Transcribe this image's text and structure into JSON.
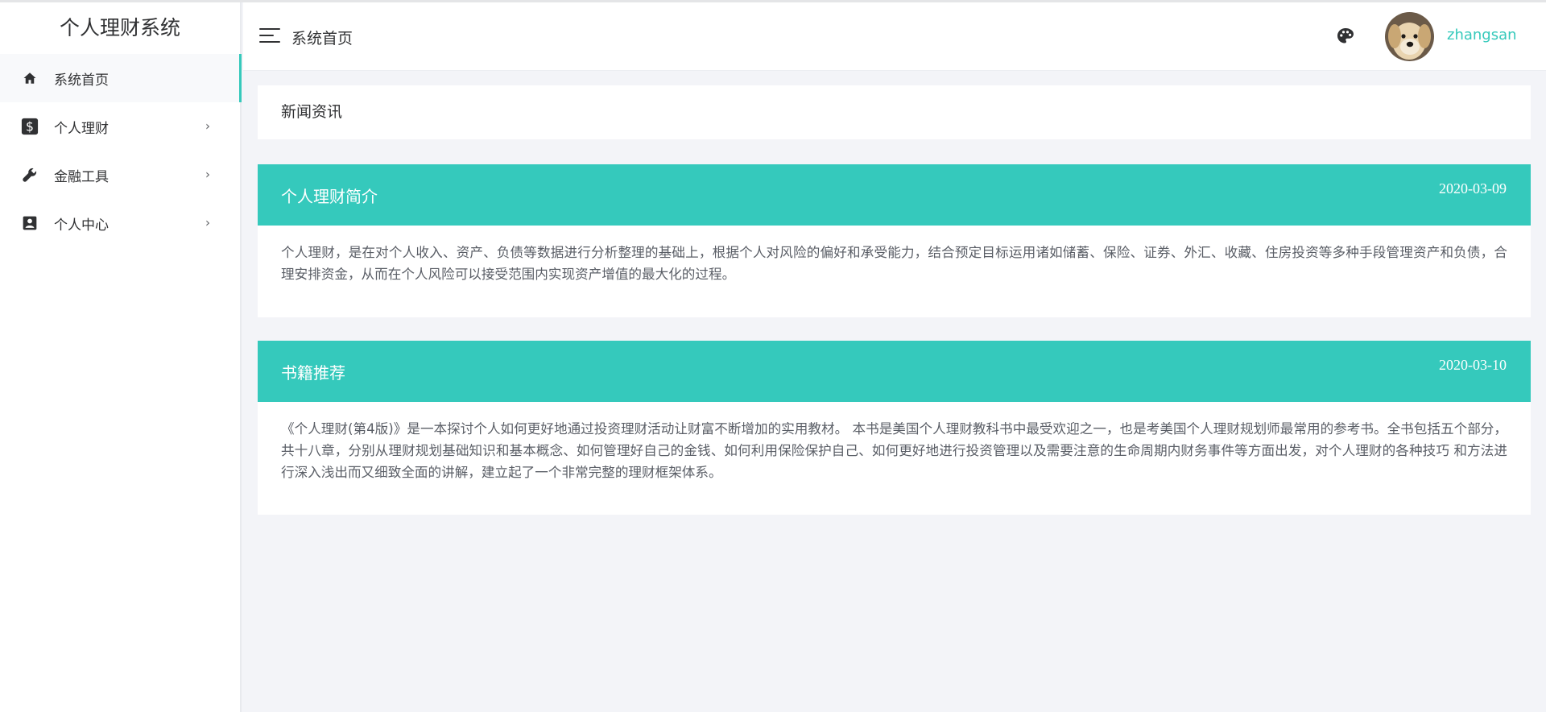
{
  "app": {
    "title": "个人理财系统"
  },
  "sidebar": {
    "items": [
      {
        "label": "系统首页",
        "icon": "home-icon",
        "active": true
      },
      {
        "label": "个人理财",
        "icon": "dollar-icon",
        "arrow": "›"
      },
      {
        "label": "金融工具",
        "icon": "wrench-icon",
        "arrow": "›"
      },
      {
        "label": "个人中心",
        "icon": "contact-card-icon",
        "arrow": "›"
      }
    ]
  },
  "header": {
    "title": "系统首页",
    "username": "zhangsan",
    "icons": [
      "menu-toggle-icon",
      "palette-icon",
      "avatar"
    ]
  },
  "main": {
    "section_title": "新闻资讯",
    "cards": [
      {
        "title": "个人理财简介",
        "date": "2020-03-09",
        "body": "个人理财，是在对个人收入、资产、负债等数据进行分析整理的基础上，根据个人对风险的偏好和承受能力，结合预定目标运用诸如储蓄、保险、证券、外汇、收藏、住房投资等多种手段管理资产和负债，合理安排资金，从而在个人风险可以接受范围内实现资产增值的最大化的过程。"
      },
      {
        "title": "书籍推荐",
        "date": "2020-03-10",
        "body": "《个人理财(第4版)》是一本探讨个人如何更好地通过投资理财活动让财富不断增加的实用教材。 本书是美国个人理财教科书中最受欢迎之一，也是考美国个人理财规划师最常用的参考书。全书包括五个部分，共十八章，分别从理财规划基础知识和基本概念、如何管理好自己的金钱、如何利用保险保护自己、如何更好地进行投资管理以及需要注意的生命周期内财务事件等方面出发，对个人理财的各种技巧 和方法进行深入浅出而又细致全面的讲解，建立起了一个非常完整的理财框架体系。"
      }
    ]
  },
  "colors": {
    "accent": "#36c9bb",
    "background": "#f3f4f8",
    "sidebar_bg": "#ffffff",
    "text": "#303133"
  }
}
